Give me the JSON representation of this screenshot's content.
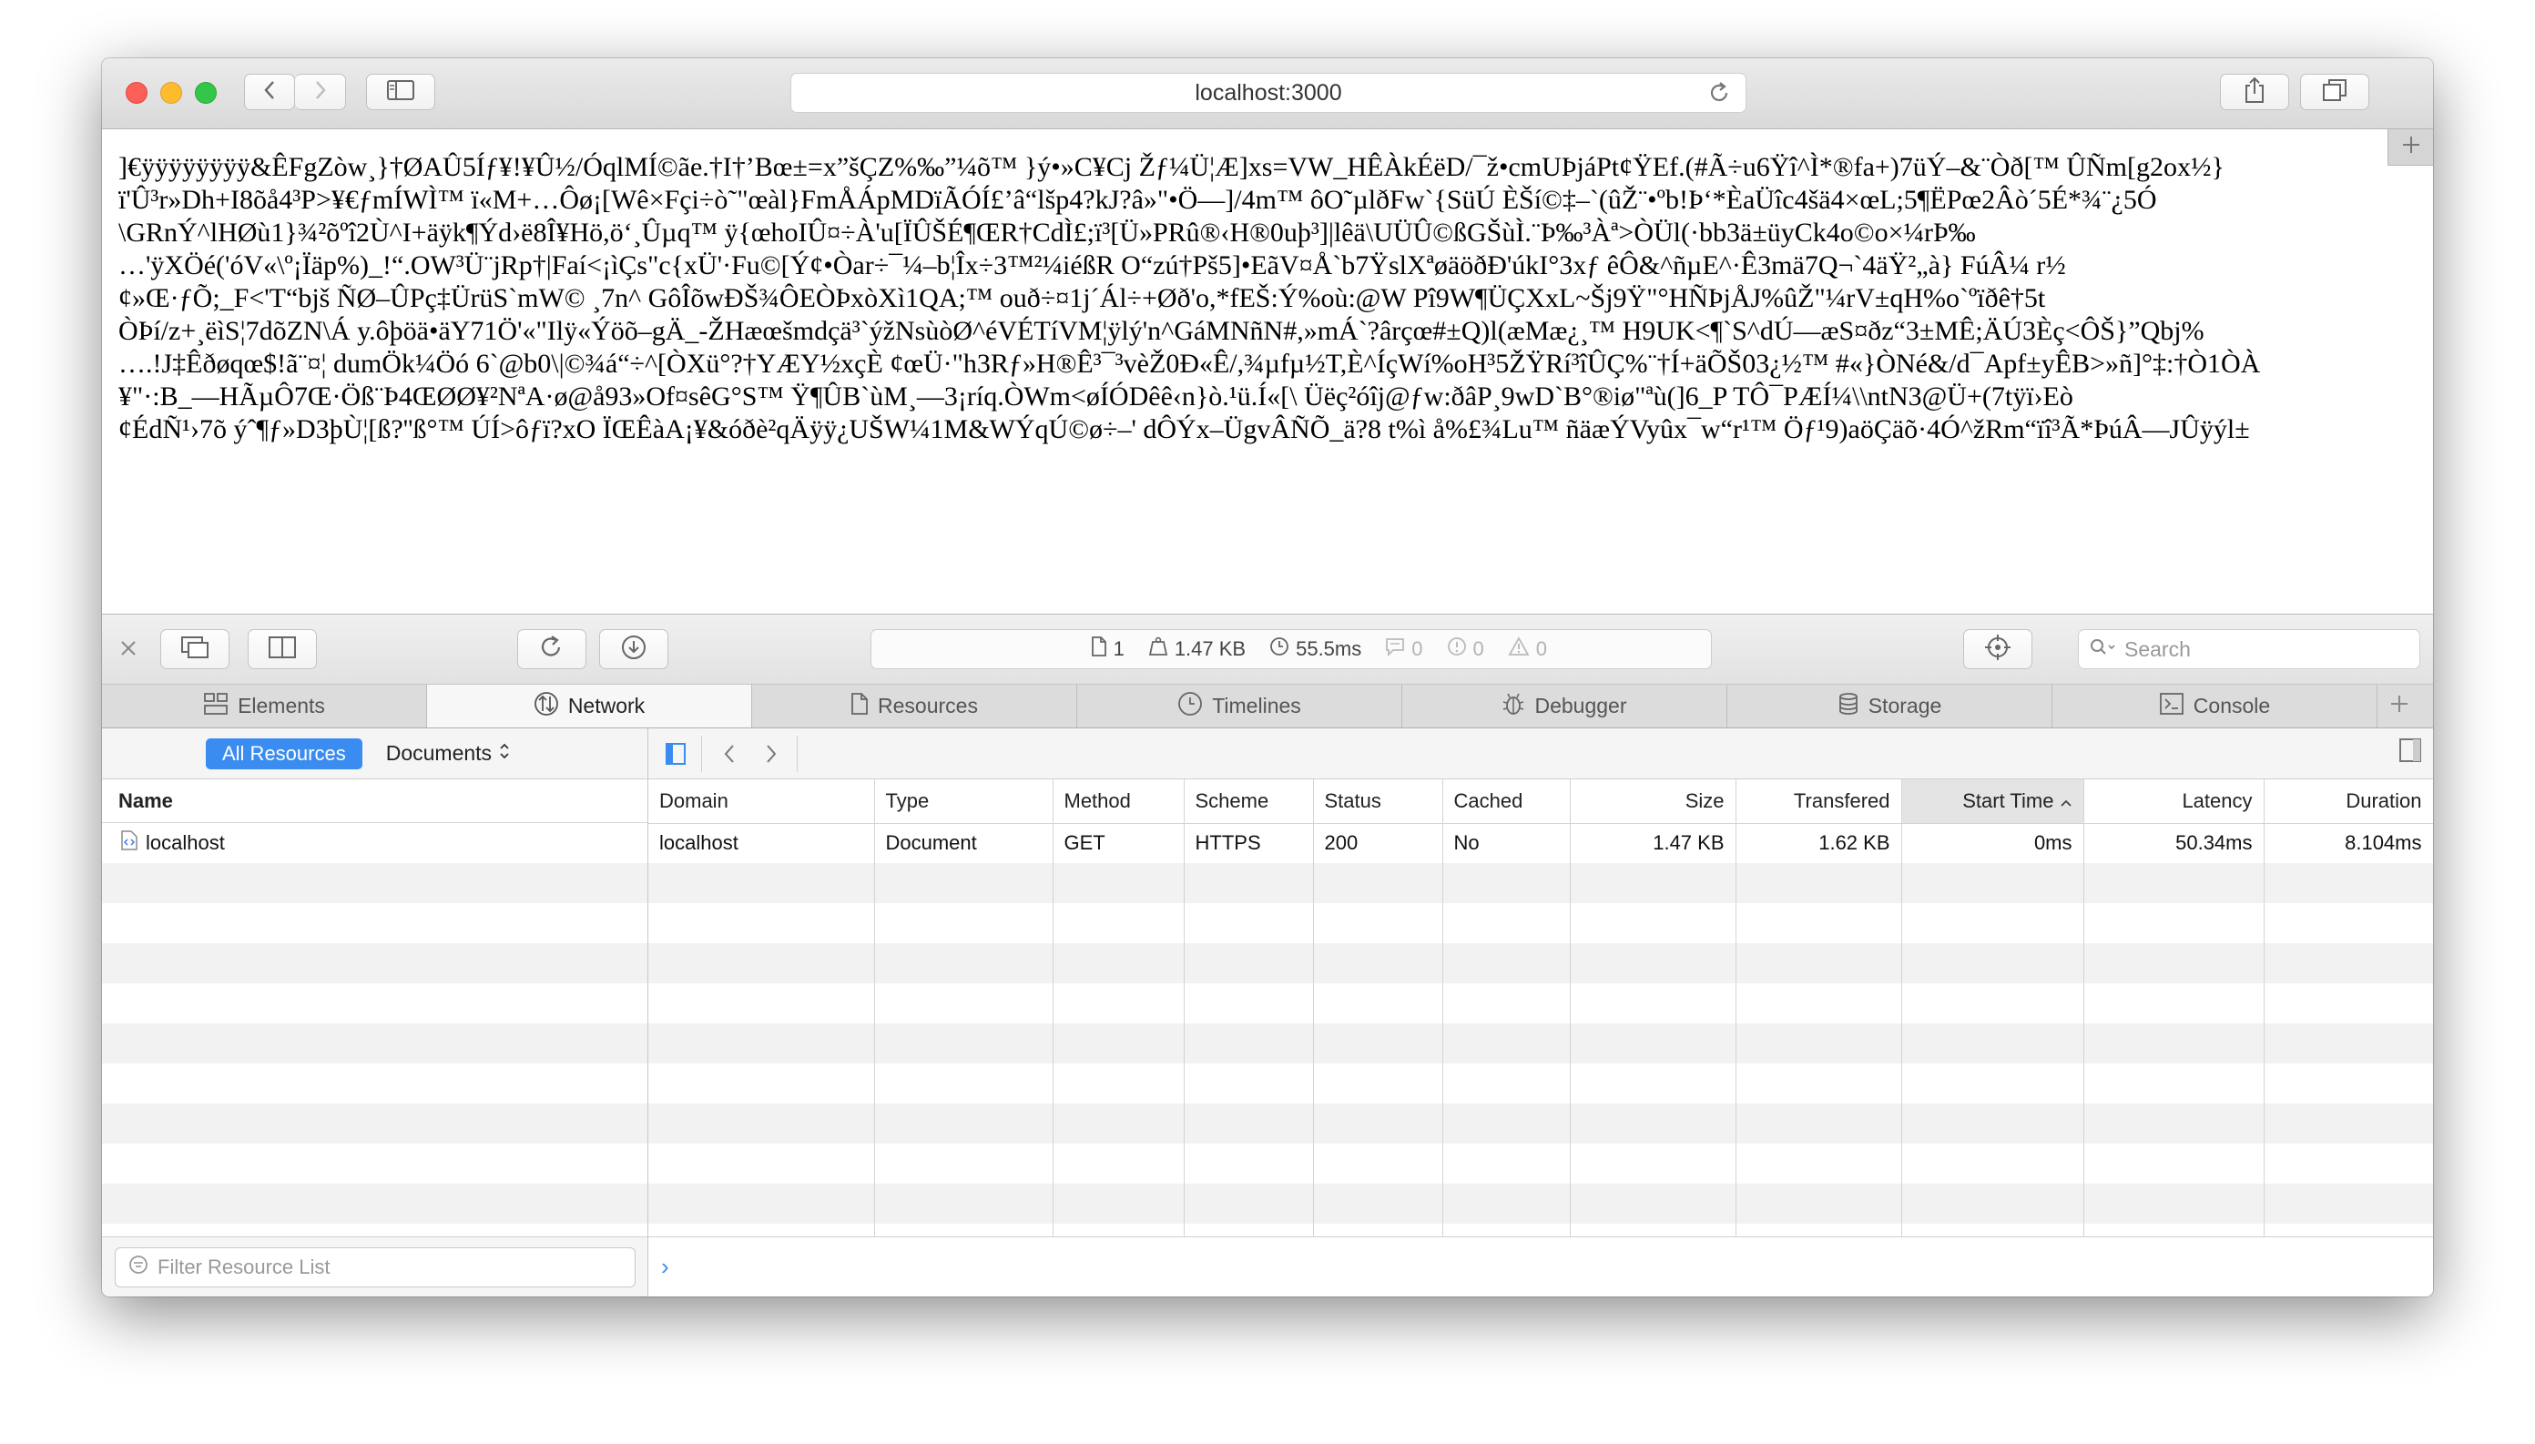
{
  "browser": {
    "address": "localhost:3000"
  },
  "page": {
    "lines": [
      "]€ÿÿÿÿÿÿÿÿ&ÊFgZòw¸}†ØAÛ5Íƒ¥!¥Û½/ÓqlMÍ©ãe.†I†’Bœ±=x”šÇZ%‰”¼õ™ }ý•»C¥Cj Žƒ¼Ü¦Æ]xs=VW_HÊÀkÉëD/¯ž•cmUÞjáPt¢ŸEf.(#Ã÷u6Ÿî^Ì*®fa+)7üÝ–&¨Òð[™ ÛÑm[g2ox½}",
      "ï'Û³r»Dh+I8õå4³P>¥€ƒmÍWÌ™ ï«M+…Ôø¡[Wê×Fçi÷ò˜\"œàl}FmÅÁpMDïÃÓÍ£’â“lšp4?kJ?â»\"•Ö—]/4m™ ôO˜µlðFw`{SüÚ ÈŠí©‡–`(ûŽ¨•ºb!Þ‘*ÈaÜîc4šä4×œL;5¶ËPœ2Âò´5É*¾¨¿5Ó",
      "\\GRnÝ^lHØù1}¾²õºî2Ù^I+äÿk¶Ýd›ë8Î¥Hö,ö‘¸Ûµq™ ÿ{œhoIÛ¤÷À'u[ÏÛŠÉ¶ŒR†CdÌ£;ï³[Ü»PRû®‹H®0uþ³]|lêä\\UÜÛ©ßGŠùÌ.¨Þ‰³Àª>ÒÜl(·bb3ä±üyCk4o©o×¼rÞ‰",
      "…'ÿXÖé('óV«\\º¡Ïäp%)_!“.OW³Ü¨jRp†|Faí<¡ìÇs\"c{xÜ'·Fu©[Ý¢•Òar÷¯¼–b¦Îx÷3™²¼iéßR O“zú†Pš5]•EãV¤Å`b7ŸslXªøäöðÐ'úkI°3xƒ êÔ&^ñµE^·Ê3mä7Q¬`4äŸ²„à} FúÂ¼ r½",
      "¢»Œ·ƒÕ;_F<'T“bjš ÑØ–ÛPç‡ÜrüS`mW© ¸7n^ GôÎõwÐŠ¾ÔEÒÞxòXì1QA;™ ouð÷¤1j´Ál÷+Øð'o,*fEŠ:Ý%où:@W Pî9W¶ÜÇXxL~Šj9Ÿ\"°HÑÞjÅJ%ûŽ\"¼rV±qH%o`ºïðê†5t",
      "ÒÞí/z+¸ëìS¦7dõZN\\Á y.ôþöä•äY71Ö'«\"Ilÿ«Ýöõ–gÄ_-ŽHæœšmdçä³`ýžNsùòØ^éVÉTíVM¦ÿlý'n^GáMNñN#,»mÁ`?ârçœ#±Q)l(æMæ¿¸™ H9UK<¶`S^dÚ—æS¤ðz“3±MÊ;ÄÚ3Èç<ÔŠ}”Qbj%",
      "….!J‡Êðøqœ$!ã¨¤¦ dumÖk¼Öó 6`@b0\\|©¾á“÷^[ÒXü°?†YÆY½xçÈ ¢œÜ·\"h3Rƒ»H®Ê³¯³vèŽ0Ð«Ê/,¾µfµ½T,È^ÍçWí%oH³5ŽŸRí³îÛÇ%¨†Í+äÕŠ03¿½™ #«}ÒNé&/d¯Apf±yÊB>»ñ]°‡:†Ò1ÒÀ",
      "¥\"·:B_—HÃµÔ7Œ·Öß¨Þ4ŒØØ¥²NªA·ø@å93»Of¤sêG°S™ Ÿ¶ÛB`ùM¸—3¡ríq.ÒWm<øÍÓDêê‹n}ò.¹ü.Í«[\\ Üëç²óîj@ƒw:ðâP¸9wD`B°®iø\"ªù(]6_P TÔ¯PÆÍ¼\\\\ntN3@Ü+(7tÿï›Eò",
      "¢ÉdÑ¹›7õ ýˆ¶ƒ»D3þÙ¦[ß?''ß°™ ÚÍ>ôƒï?xO ÏŒÊàA¡¥&óðè²qÄÿÿ¿UŠW¼1M&WÝqÚ©ø÷–' dÔÝx–ÜgvÂÑÕ_ä?8 t%ì å%£¾Lu™ ñäæÝVyûx¯w“r¹™ Öƒ¹9)aöÇäõ·4Ó^žRm“ïî³Ã*ÞúÂ—JÛÿýl±"
    ]
  },
  "devtools": {
    "dashboard": {
      "resources": "1",
      "size": "1.47 KB",
      "time": "55.5ms",
      "logs": "0",
      "errors": "0",
      "warnings": "0"
    },
    "search_placeholder": "Search",
    "tabs": [
      "Elements",
      "Network",
      "Resources",
      "Timelines",
      "Debugger",
      "Storage",
      "Console"
    ],
    "active_tab": "Network",
    "sidebar": {
      "filter_all": "All Resources",
      "filter_docs": "Documents",
      "name_header": "Name",
      "items": [
        "localhost"
      ],
      "filter_placeholder": "Filter Resource List"
    },
    "grid": {
      "columns": [
        "Domain",
        "Type",
        "Method",
        "Scheme",
        "Status",
        "Cached",
        "Size",
        "Transfered",
        "Start Time",
        "Latency",
        "Duration"
      ],
      "sorted_column": "Start Time",
      "rows": [
        [
          "localhost",
          "Document",
          "GET",
          "HTTPS",
          "200",
          "No",
          "1.47 KB",
          "1.62 KB",
          "0ms",
          "50.34ms",
          "8.104ms"
        ]
      ]
    },
    "console_prompt": "›"
  }
}
